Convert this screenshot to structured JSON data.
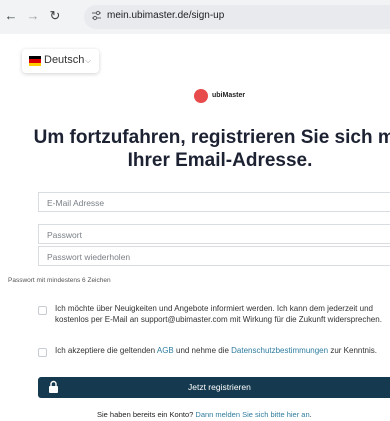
{
  "browser": {
    "url": "mein.ubimaster.de/sign-up",
    "back_icon": "arrow-left-icon",
    "forward_icon": "arrow-right-icon",
    "reload_icon": "reload-icon"
  },
  "language": {
    "label": "Deutsch",
    "flag_colors": [
      "#000000",
      "#dd0000",
      "#ffce00"
    ]
  },
  "brand": {
    "name": "ubiMaster",
    "accent_color": "#e84b4b"
  },
  "headline": {
    "line1": "Um fortzufahren, registrieren Sie sich mit",
    "line2": "Ihrer Email-Adresse."
  },
  "form": {
    "email_placeholder": "E-Mail Adresse",
    "password_placeholder": "Passwort",
    "password_repeat_placeholder": "Passwort wiederholen",
    "password_hint": "Passwort mit mindestens 6 Zeichen",
    "newsletter_text": "Ich möchte über Neuigkeiten und Angebote informiert werden. Ich kann dem jederzeit und kostenlos per E-Mail an support@ubimaster.com mit Wirkung für die Zukunft widersprechen.",
    "terms_prefix": "Ich akzeptiere die geltenden ",
    "terms_agb": "AGB",
    "terms_middle": " und nehme die ",
    "terms_privacy": "Datenschutzbestimmungen",
    "terms_suffix": " zur Kenntnis.",
    "submit_label": "Jetzt registrieren",
    "submit_color": "#153a4f"
  },
  "footer": {
    "prefix": "Sie haben bereits ein Konto? ",
    "link": "Dann melden Sie sich bitte hier an",
    "suffix": "."
  }
}
